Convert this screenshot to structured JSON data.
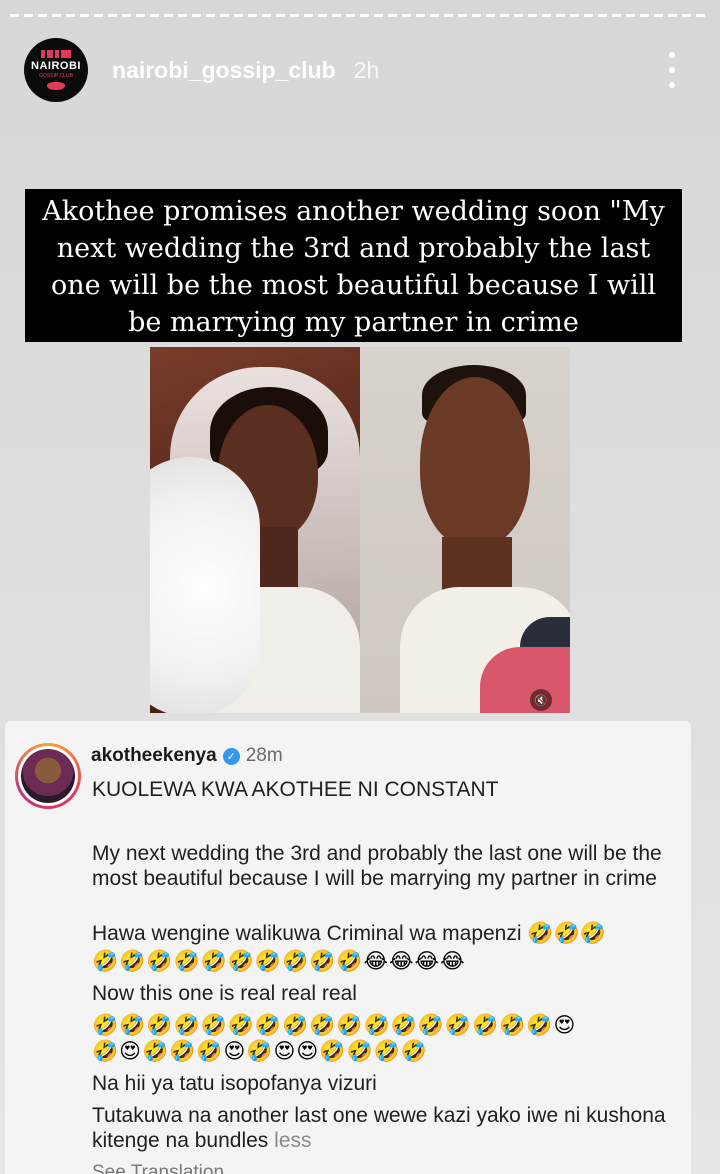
{
  "story": {
    "username": "nairobi_gossip_club",
    "time": "2h",
    "avatar_logo": {
      "top": "NAIROBI",
      "sub": "GOSSIP CLUB"
    },
    "headline": "Akothee promises another wedding  soon \"My next wedding the 3rd and probably the last one will be the most beautiful because I will be marrying my partner in crime"
  },
  "comment": {
    "username": "akotheekenya",
    "time": "28m",
    "lines": [
      "KUOLEWA KWA AKOTHEE NI CONSTANT",
      "My next wedding the 3rd and probably the last one will be the most beautiful because I will be marrying my partner in crime",
      "Hawa wengine walikuwa Criminal wa mapenzi 🤣🤣🤣",
      "🤣🤣🤣🤣🤣🤣🤣🤣🤣🤣😂😂😂😂",
      "Now this one is real real real",
      "🤣🤣🤣🤣🤣🤣🤣🤣🤣🤣🤣🤣🤣🤣🤣🤣🤣😍",
      "🤣😍🤣🤣🤣😍🤣😍😍🤣🤣🤣🤣",
      "Na hii ya tatu isopofanya vizuri",
      "Tutakuwa na another last one wewe kazi yako iwe ni kushona kitenge na  bundles"
    ],
    "less_label": "less",
    "see_translation": "See Translation"
  }
}
